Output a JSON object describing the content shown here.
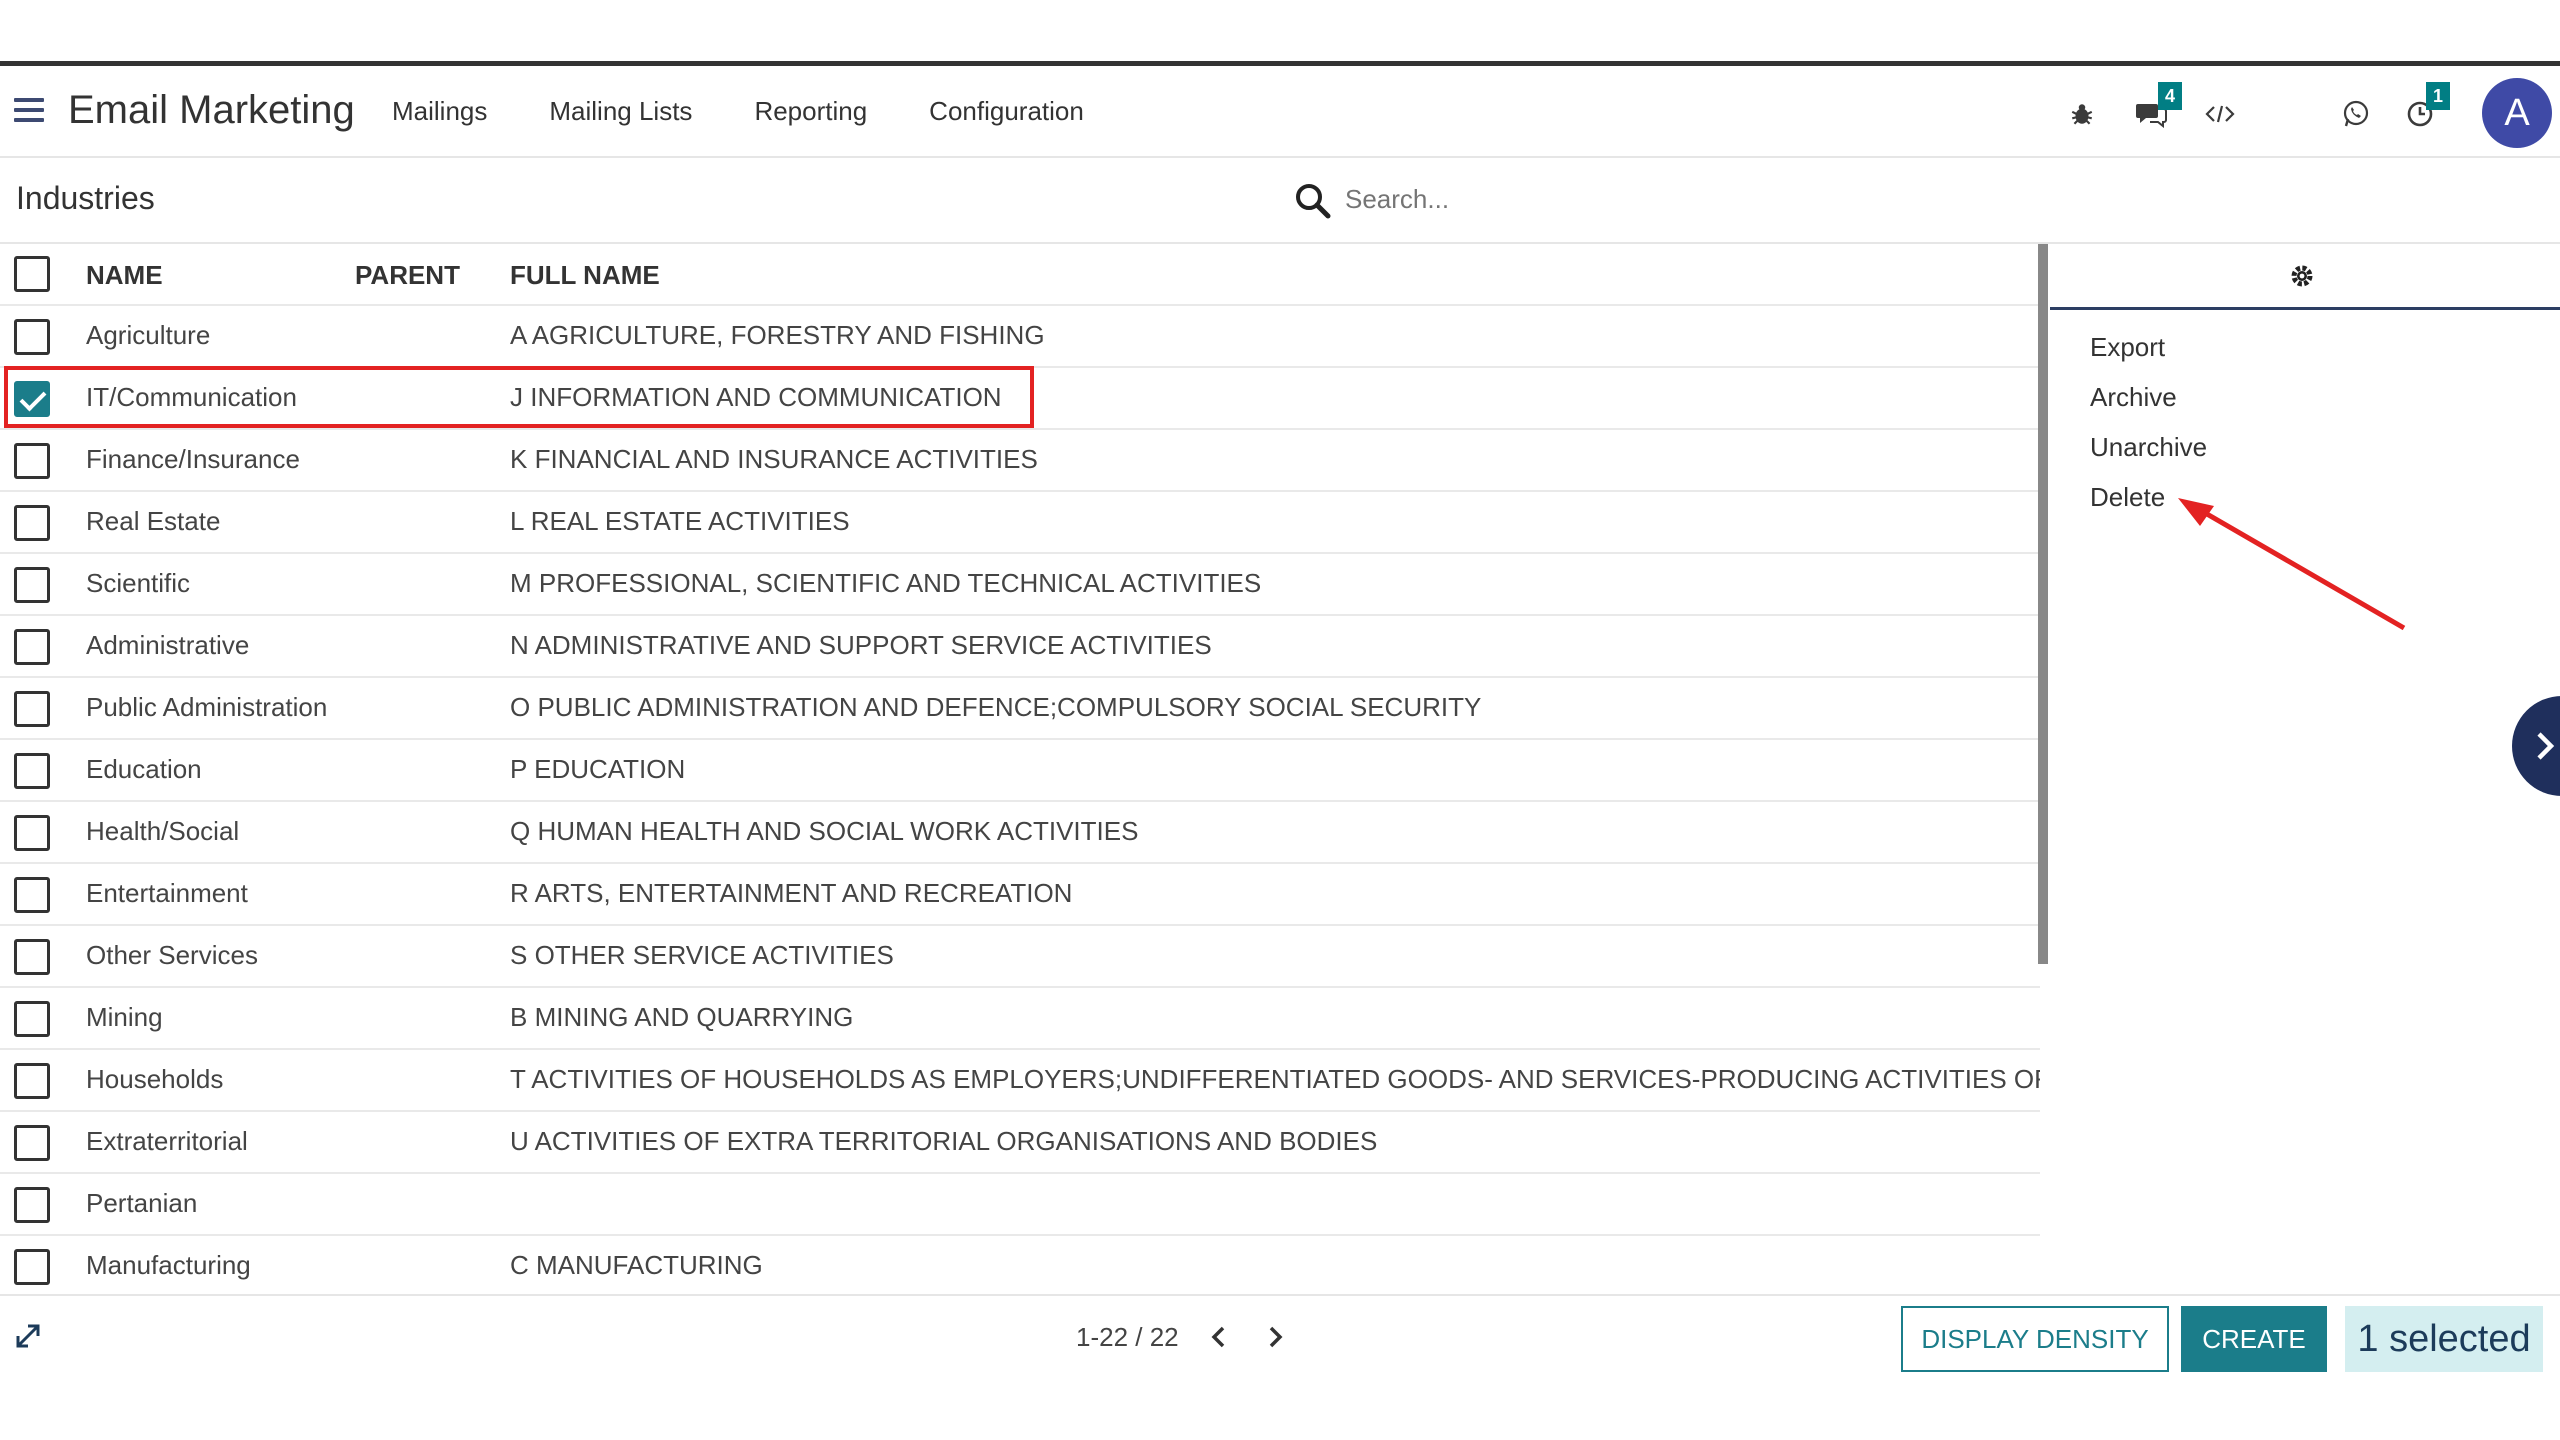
{
  "app": {
    "title": "Email Marketing",
    "menu": [
      "Mailings",
      "Mailing Lists",
      "Reporting",
      "Configuration"
    ],
    "icons": [
      "bug-icon",
      "chat-icon",
      "code-icon",
      "whatsapp-icon",
      "activity-clock-icon"
    ],
    "chat_badge": "4",
    "activity_badge": "1",
    "avatar_letter": "A"
  },
  "control": {
    "breadcrumb": "Industries",
    "search_placeholder": "Search..."
  },
  "table": {
    "headers": {
      "name": "NAME",
      "parent": "PARENT",
      "full_name": "FULL NAME"
    },
    "rows": [
      {
        "name": "Agriculture",
        "parent": "",
        "full_name": "A AGRICULTURE, FORESTRY AND FISHING",
        "checked": false
      },
      {
        "name": "IT/Communication",
        "parent": "",
        "full_name": "J INFORMATION AND COMMUNICATION",
        "checked": true
      },
      {
        "name": "Finance/Insurance",
        "parent": "",
        "full_name": "K FINANCIAL AND INSURANCE ACTIVITIES",
        "checked": false
      },
      {
        "name": "Real Estate",
        "parent": "",
        "full_name": "L REAL ESTATE ACTIVITIES",
        "checked": false
      },
      {
        "name": "Scientific",
        "parent": "",
        "full_name": "M PROFESSIONAL, SCIENTIFIC AND TECHNICAL ACTIVITIES",
        "checked": false
      },
      {
        "name": "Administrative",
        "parent": "",
        "full_name": "N ADMINISTRATIVE AND SUPPORT SERVICE ACTIVITIES",
        "checked": false
      },
      {
        "name": "Public Administration",
        "parent": "",
        "full_name": "O PUBLIC ADMINISTRATION AND DEFENCE;COMPULSORY SOCIAL SECURITY",
        "checked": false
      },
      {
        "name": "Education",
        "parent": "",
        "full_name": "P EDUCATION",
        "checked": false
      },
      {
        "name": "Health/Social",
        "parent": "",
        "full_name": "Q HUMAN HEALTH AND SOCIAL WORK ACTIVITIES",
        "checked": false
      },
      {
        "name": "Entertainment",
        "parent": "",
        "full_name": "R ARTS, ENTERTAINMENT AND RECREATION",
        "checked": false
      },
      {
        "name": "Other Services",
        "parent": "",
        "full_name": "S OTHER SERVICE ACTIVITIES",
        "checked": false
      },
      {
        "name": "Mining",
        "parent": "",
        "full_name": "B MINING AND QUARRYING",
        "checked": false
      },
      {
        "name": "Households",
        "parent": "",
        "full_name": "T ACTIVITIES OF HOUSEHOLDS AS EMPLOYERS;UNDIFFERENTIATED GOODS- AND SERVICES-PRODUCING ACTIVITIES OF H",
        "checked": false
      },
      {
        "name": "Extraterritorial",
        "parent": "",
        "full_name": "U ACTIVITIES OF EXTRA TERRITORIAL ORGANISATIONS AND BODIES",
        "checked": false
      },
      {
        "name": "Pertanian",
        "parent": "",
        "full_name": "",
        "checked": false
      },
      {
        "name": "Manufacturing",
        "parent": "",
        "full_name": "C MANUFACTURING",
        "checked": false
      }
    ]
  },
  "side_panel": {
    "items": [
      "Export",
      "Archive",
      "Unarchive",
      "Delete"
    ]
  },
  "footer": {
    "pager": "1-22 / 22",
    "display_density": "DISPLAY DENSITY",
    "create": "CREATE",
    "selected": "1 selected"
  },
  "colors": {
    "accent": "#1b7d8a",
    "badge": "#017e84",
    "avatar": "#3f4aa6",
    "highlight": "#e32222"
  }
}
